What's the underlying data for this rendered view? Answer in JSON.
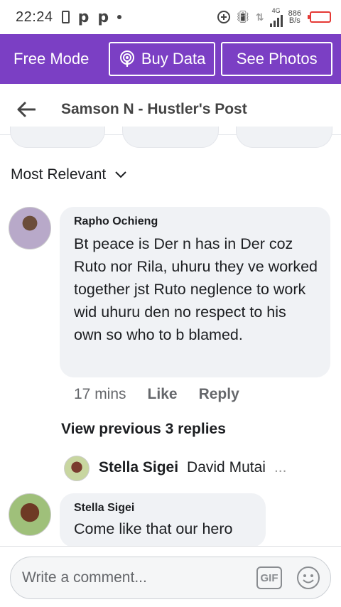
{
  "status_bar": {
    "time": "22:24",
    "network_type": "4G",
    "speed_value": "886",
    "speed_unit": "B/s"
  },
  "top_bar": {
    "free_mode_label": "Free Mode",
    "buy_data_label": "Buy Data",
    "see_photos_label": "See Photos",
    "accent_color": "#7b3fc4"
  },
  "header": {
    "title": "Samson N - Hustler's Post"
  },
  "sort": {
    "label": "Most Relevant"
  },
  "comments": [
    {
      "author": "Rapho Ochieng",
      "text": "Bt peace is Der n has in Der coz Ruto nor Rila, uhuru they ve worked together jst Ruto neglence to work wid uhuru den no respect to his own so who to b blamed.",
      "time": "17 mins",
      "like_label": "Like",
      "reply_label": "Reply",
      "view_previous_label": "View previous 3 replies",
      "reply_preview": {
        "author": "Stella Sigei",
        "snippet": "David Mutai",
        "ellipsis": "..."
      }
    },
    {
      "author": "Stella Sigei",
      "text": "Come like that our hero"
    }
  ],
  "composer": {
    "placeholder": "Write a comment...",
    "gif_label": "GIF"
  }
}
